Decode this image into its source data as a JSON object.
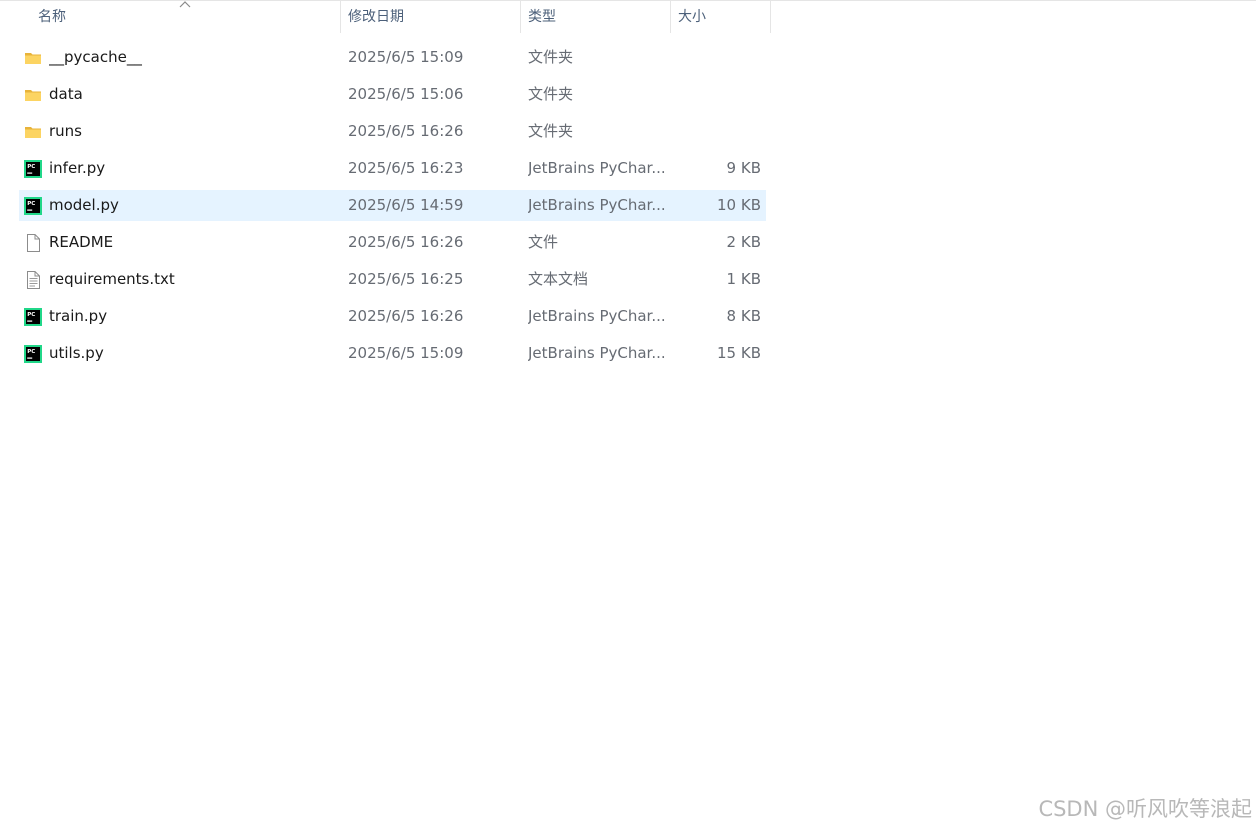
{
  "header": {
    "name_label": "名称",
    "date_label": "修改日期",
    "type_label": "类型",
    "size_label": "大小",
    "sort_icon": "sort-ascending-icon"
  },
  "files": [
    {
      "name": "__pycache__",
      "date": "2025/6/5 15:09",
      "type": "文件夹",
      "size": "",
      "icon": "folder-icon",
      "selected": false
    },
    {
      "name": "data",
      "date": "2025/6/5 15:06",
      "type": "文件夹",
      "size": "",
      "icon": "folder-icon",
      "selected": false
    },
    {
      "name": "runs",
      "date": "2025/6/5 16:26",
      "type": "文件夹",
      "size": "",
      "icon": "folder-icon",
      "selected": false
    },
    {
      "name": "infer.py",
      "date": "2025/6/5 16:23",
      "type": "JetBrains PyChar...",
      "size": "9 KB",
      "icon": "pycharm-file-icon",
      "selected": false
    },
    {
      "name": "model.py",
      "date": "2025/6/5 14:59",
      "type": "JetBrains PyChar...",
      "size": "10 KB",
      "icon": "pycharm-file-icon",
      "selected": true
    },
    {
      "name": "README",
      "date": "2025/6/5 16:26",
      "type": "文件",
      "size": "2 KB",
      "icon": "blank-file-icon",
      "selected": false
    },
    {
      "name": "requirements.txt",
      "date": "2025/6/5 16:25",
      "type": "文本文档",
      "size": "1 KB",
      "icon": "text-file-icon",
      "selected": false
    },
    {
      "name": "train.py",
      "date": "2025/6/5 16:26",
      "type": "JetBrains PyChar...",
      "size": "8 KB",
      "icon": "pycharm-file-icon",
      "selected": false
    },
    {
      "name": "utils.py",
      "date": "2025/6/5 15:09",
      "type": "JetBrains PyChar...",
      "size": "15 KB",
      "icon": "pycharm-file-icon",
      "selected": false
    }
  ],
  "watermark": "CSDN @听风吹等浪起",
  "colors": {
    "selection": "#e5f3ff",
    "header_text": "#4c607a",
    "folder": "#f8c94d",
    "pycharm_green": "#21d789"
  }
}
